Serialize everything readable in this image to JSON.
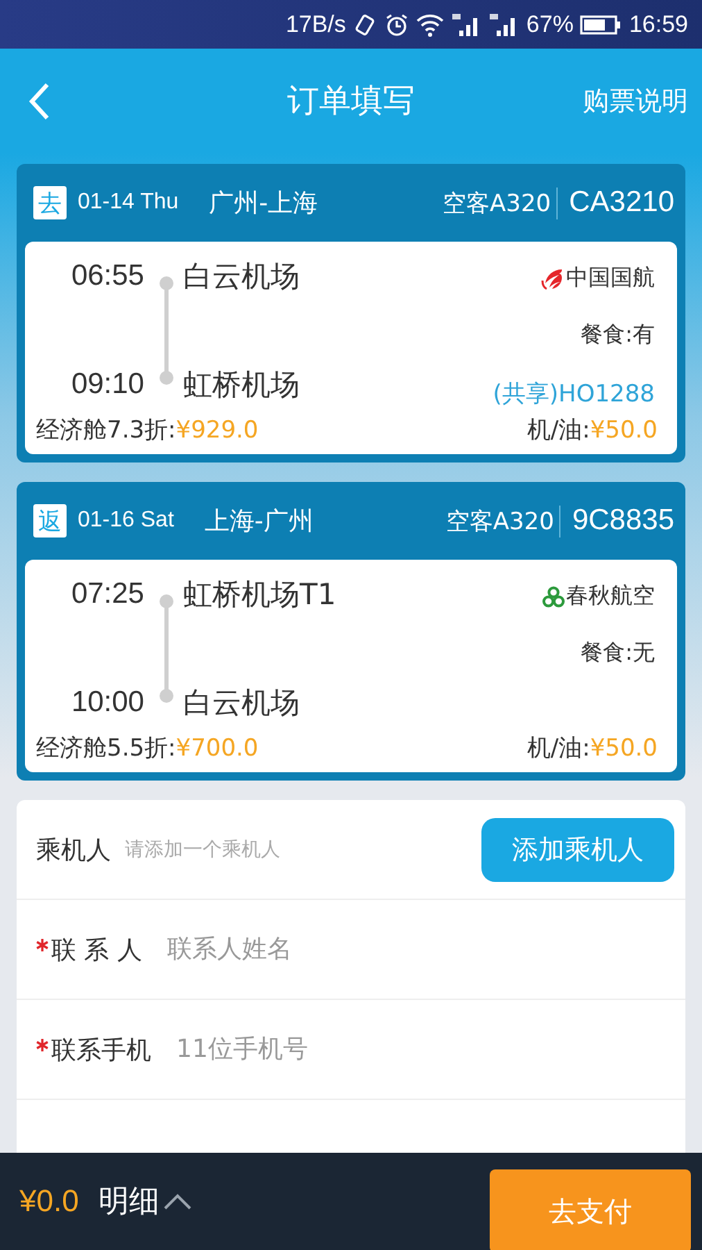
{
  "status_bar": {
    "speed": "17B/s",
    "battery": "67%",
    "time": "16:59"
  },
  "header": {
    "title": "订单填写",
    "link": "购票说明"
  },
  "flights": [
    {
      "badge": "去",
      "date": "01-14 Thu",
      "route": "广州-上海",
      "aircraft": "空客A320",
      "flight_no": "CA3210",
      "depart_time": "06:55",
      "depart_airport": "白云机场",
      "arrive_time": "09:10",
      "arrive_airport": "虹桥机场",
      "kind": "phoenix",
      "airline": "中国国航",
      "meal": "餐食:有",
      "codeshare": "(共享)HO1288",
      "fare_label": "经济舱7.3折:",
      "fare_price": "¥929.0",
      "tax_label": "机/油:",
      "tax_price": "¥50.0"
    },
    {
      "badge": "返",
      "date": "01-16 Sat",
      "route": "上海-广州",
      "aircraft": "空客A320",
      "flight_no": "9C8835",
      "depart_time": "07:25",
      "depart_airport": "虹桥机场T1",
      "arrive_time": "10:00",
      "arrive_airport": "白云机场",
      "kind": "trefoil",
      "airline": "春秋航空",
      "meal": "餐食:无",
      "fare_label": "经济舱5.5折:",
      "fare_price": "¥700.0",
      "tax_label": "机/油:",
      "tax_price": "¥50.0"
    }
  ],
  "passenger": {
    "label": "乘机人",
    "hint": "请添加一个乘机人",
    "button": "添加乘机人"
  },
  "fields": [
    {
      "required": true,
      "label": "联 系 人",
      "placeholder": "联系人姓名"
    },
    {
      "required": true,
      "label": "联系手机",
      "placeholder": "11位手机号"
    }
  ],
  "bottom_bar": {
    "total": "¥0.0",
    "detail": "明细",
    "pay_button": "去支付"
  }
}
